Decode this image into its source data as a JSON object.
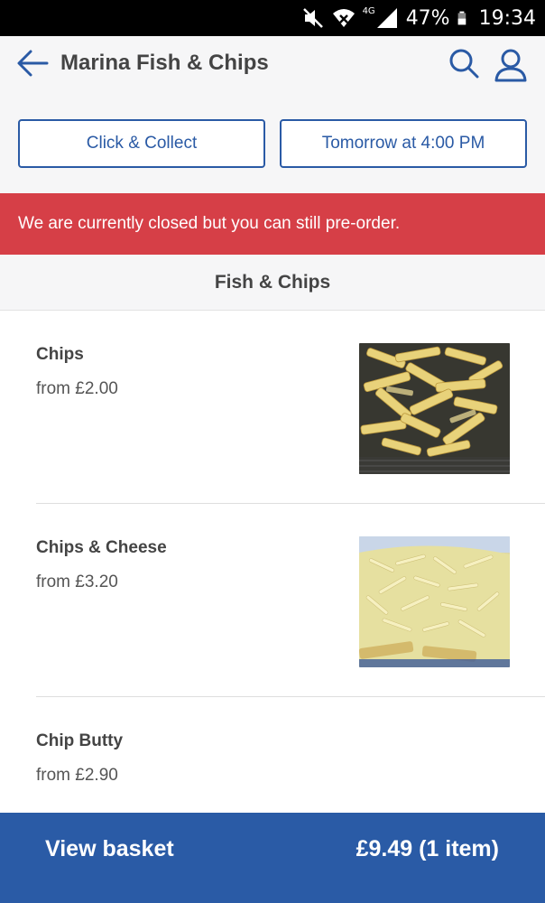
{
  "status_bar": {
    "network": "4G",
    "battery": "47%",
    "time": "19:34",
    "icons": [
      "mute-icon",
      "wifi-icon",
      "signal-icon",
      "battery-icon"
    ]
  },
  "header": {
    "title": "Marina Fish & Chips",
    "icons": [
      "back-arrow-icon",
      "search-icon",
      "account-icon"
    ],
    "accent_color": "#2a5aa5"
  },
  "order_options": {
    "mode_label": "Click & Collect",
    "time_label": "Tomorrow at 4:00 PM"
  },
  "banner": {
    "text": "We are currently closed but you can still pre-order.",
    "color": "#d63f47"
  },
  "category": {
    "title": "Fish & Chips"
  },
  "items": [
    {
      "name": "Chips",
      "price": "from £2.00",
      "has_image": true,
      "image_subject": "chips"
    },
    {
      "name": "Chips & Cheese",
      "price": "from £3.20",
      "has_image": true,
      "image_subject": "chips-and-cheese"
    },
    {
      "name": "Chip Butty",
      "price": "from £2.90",
      "has_image": false
    }
  ],
  "basket": {
    "label": "View basket",
    "total": "£9.49 (1 item)",
    "color": "#2a5ba6"
  }
}
